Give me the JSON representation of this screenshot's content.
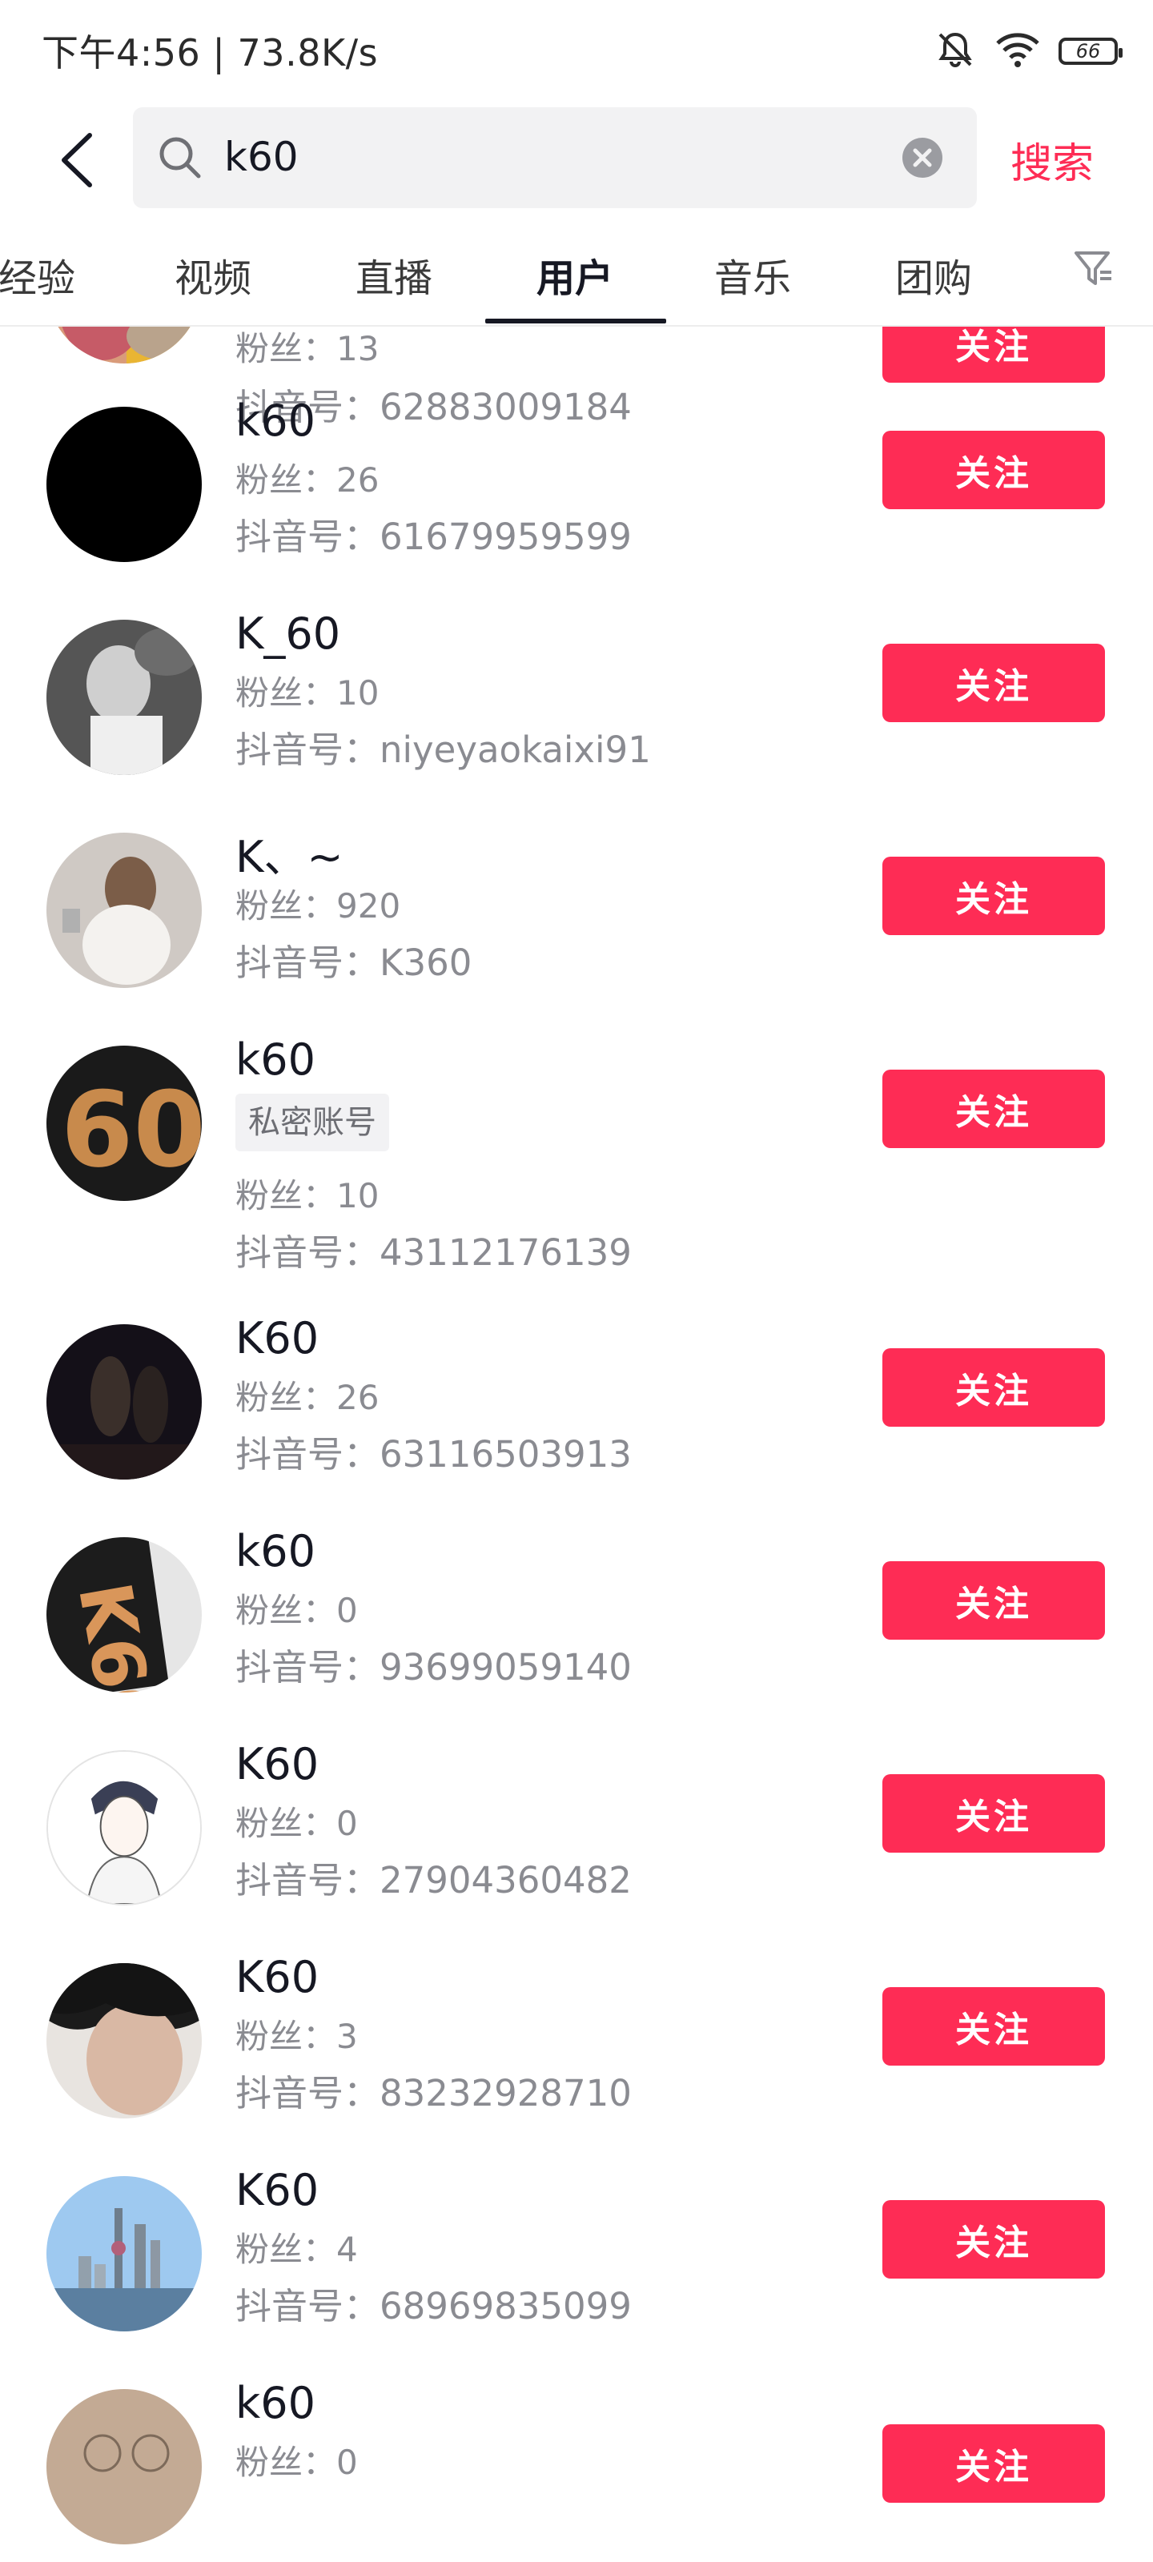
{
  "status_bar": {
    "text": "下午4:56 | 73.8K/s",
    "battery": "66"
  },
  "search": {
    "value": "k60",
    "button_label": "搜索"
  },
  "tabs": [
    {
      "label": "经验"
    },
    {
      "label": "视频"
    },
    {
      "label": "直播"
    },
    {
      "label": "用户"
    },
    {
      "label": "音乐"
    },
    {
      "label": "团购"
    }
  ],
  "active_tab": "用户",
  "colors": {
    "accent": "#fe2c55",
    "text": "#161823",
    "secondary": "#8a8b91"
  },
  "results": [
    {
      "name": "",
      "fans": "粉丝：13",
      "douyin_id": "抖音号：62883009184",
      "follow": "关注"
    },
    {
      "name": "k60",
      "fans": "粉丝：26",
      "douyin_id": "抖音号：61679959599",
      "follow": "关注"
    },
    {
      "name": "K_60",
      "fans": "粉丝：10",
      "douyin_id": "抖音号：niyeyaokaixi91",
      "follow": "关注"
    },
    {
      "name": "K、~",
      "fans": "粉丝：920",
      "douyin_id": "抖音号：K360",
      "follow": "关注"
    },
    {
      "name": "k60",
      "badge": "私密账号",
      "fans": "粉丝：10",
      "douyin_id": "抖音号：43112176139",
      "follow": "关注"
    },
    {
      "name": "K60",
      "fans": "粉丝：26",
      "douyin_id": "抖音号：63116503913",
      "follow": "关注"
    },
    {
      "name": "k60",
      "fans": "粉丝：0",
      "douyin_id": "抖音号：93699059140",
      "follow": "关注"
    },
    {
      "name": "K60",
      "fans": "粉丝：0",
      "douyin_id": "抖音号：27904360482",
      "follow": "关注"
    },
    {
      "name": "K60",
      "fans": "粉丝：3",
      "douyin_id": "抖音号：83232928710",
      "follow": "关注"
    },
    {
      "name": "K60",
      "fans": "粉丝：4",
      "douyin_id": "抖音号：68969835099",
      "follow": "关注"
    },
    {
      "name": "k60",
      "fans": "粉丝：0",
      "douyin_id": "",
      "follow": "关注"
    }
  ]
}
